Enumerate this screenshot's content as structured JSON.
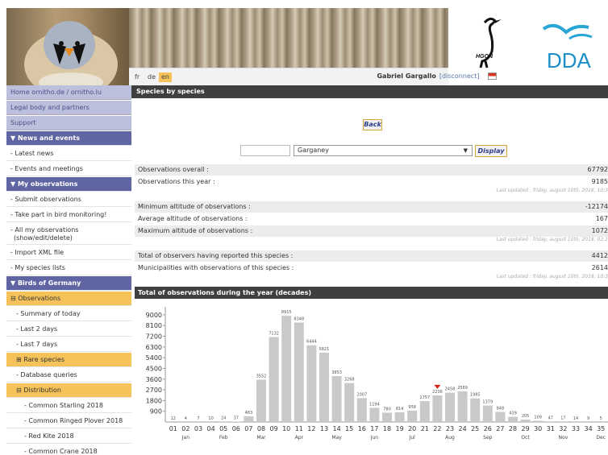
{
  "header": {
    "languages": [
      "fr",
      "de",
      "en"
    ],
    "active_language": "en",
    "user_name": "Gabriel Gargallo",
    "disconnect_label": "[disconnect]",
    "logo_hgon_text": "HGON",
    "logo_dda_text": "DDA"
  },
  "sidebar": {
    "items": [
      {
        "label": "Home ornitho.de / ornitho.lu",
        "style": "top"
      },
      {
        "label": "Legal body and partners",
        "style": "top"
      },
      {
        "label": "Support",
        "style": "top"
      },
      {
        "label": "▼ News and events",
        "style": "head"
      },
      {
        "label": "- Latest news",
        "style": ""
      },
      {
        "label": "- Events and meetings",
        "style": ""
      },
      {
        "label": "▼ My observations",
        "style": "head"
      },
      {
        "label": "- Submit observations",
        "style": ""
      },
      {
        "label": "- Take part in bird monitoring!",
        "style": ""
      },
      {
        "label": "- All my observations",
        "label2": "(show/edit/delete)",
        "style": "tall"
      },
      {
        "label": "- Import XML file",
        "style": ""
      },
      {
        "label": "- My species lists",
        "style": ""
      },
      {
        "label": "▼ Birds of Germany",
        "style": "head"
      },
      {
        "label": "⊟ Observations",
        "style": "hi"
      },
      {
        "label": "- Summary of today",
        "style": "ind1"
      },
      {
        "label": "- Last 2 days",
        "style": "ind1"
      },
      {
        "label": "- Last 7 days",
        "style": "ind1"
      },
      {
        "label": "⊞ Rare species",
        "style": "hi ind1"
      },
      {
        "label": "- Database queries",
        "style": "ind1"
      },
      {
        "label": "⊟ Distribution",
        "style": "hi ind1"
      },
      {
        "label": "- Common Starling 2018",
        "style": "ind2"
      },
      {
        "label": "- Common Ringed Plover 2018",
        "style": "ind2"
      },
      {
        "label": "- Red Kite 2018",
        "style": "ind2"
      },
      {
        "label": "- Common Crane 2018",
        "style": "ind2"
      }
    ]
  },
  "main": {
    "title": "Species by species",
    "back_label": "Back",
    "species_input_value": "",
    "species_selected": "Garganey",
    "display_label": "Display",
    "stats_group1": [
      {
        "label": "Observations overall :",
        "value": "67792"
      },
      {
        "label": "Observations this year :",
        "value": "9185"
      }
    ],
    "updated1": "Last updated : friday, august 10th, 2018, 10:3",
    "stats_group2": [
      {
        "label": "Minimum altitude of observations :",
        "value": "-12174"
      },
      {
        "label": "Average altitude of observations :",
        "value": "167"
      },
      {
        "label": "Maximum altitude of observations :",
        "value": "1072"
      }
    ],
    "updated2": "Last updated : friday, august 10th, 2018, 02:1",
    "stats_group3": [
      {
        "label": "Total of observers having reported this species :",
        "value": "4412"
      },
      {
        "label": "Municipalities with observations of this species :",
        "value": "2614"
      }
    ],
    "updated3": "Last updated : friday, august 10th, 2018, 10:3"
  },
  "chart_data": {
    "type": "bar",
    "title": "Total of observations during the year (decades)",
    "categories": [
      "01",
      "02",
      "03",
      "04",
      "05",
      "06",
      "07",
      "08",
      "09",
      "10",
      "11",
      "12",
      "13",
      "14",
      "15",
      "16",
      "17",
      "18",
      "19",
      "20",
      "21",
      "22",
      "23",
      "24",
      "25",
      "26",
      "27",
      "28",
      "29",
      "30",
      "31",
      "32",
      "33",
      "34",
      "35",
      "36"
    ],
    "values": [
      12,
      4,
      7,
      10,
      24,
      37,
      483,
      3552,
      7132,
      8915,
      8348,
      6444,
      5821,
      3853,
      3268,
      2007,
      1194,
      780,
      814,
      958,
      1757,
      2236,
      2458,
      2569,
      1985,
      1379,
      848,
      439,
      205,
      109,
      47,
      17,
      14,
      9,
      5,
      8
    ],
    "month_labels": [
      "Jan",
      "Feb",
      "Mar",
      "Apr",
      "May",
      "Jun",
      "Jul",
      "Aug",
      "Sep",
      "Oct",
      "Nov",
      "Dec"
    ],
    "ytick_labels": [
      "900",
      "1800",
      "2700",
      "3600",
      "4500",
      "5400",
      "6300",
      "7200",
      "8100",
      "9000"
    ],
    "ylim": [
      0,
      9400
    ],
    "marker_decade": "22",
    "grid": false,
    "bar_color": "#c9c9c9",
    "marker_color": "#d9261c"
  }
}
